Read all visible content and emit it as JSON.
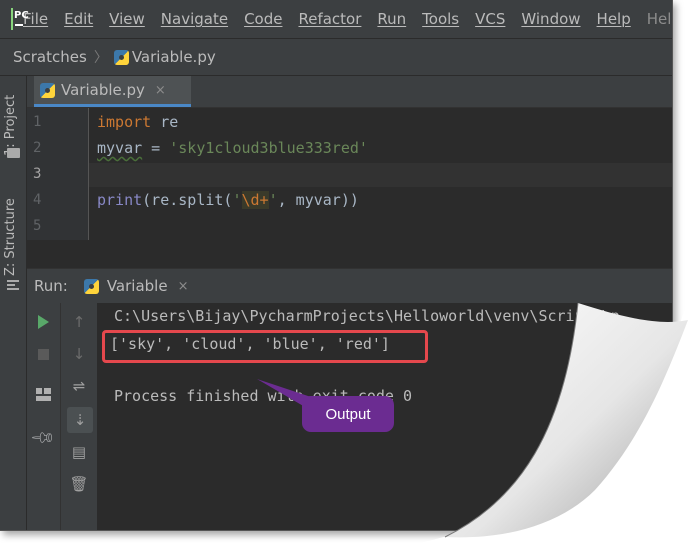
{
  "menu": {
    "items": [
      "File",
      "Edit",
      "View",
      "Navigate",
      "Code",
      "Refactor",
      "Run",
      "Tools",
      "VCS",
      "Window",
      "Help"
    ],
    "window_title": "Hello"
  },
  "breadcrumb": {
    "root": "Scratches",
    "file": "Variable.py"
  },
  "left_strip": {
    "project_tab": "1: Project",
    "structure_tab": "Z: Structure"
  },
  "editor_tab": {
    "label": "Variable.py",
    "close": "×"
  },
  "editor": {
    "line_numbers": [
      "1",
      "2",
      "3",
      "4",
      "5"
    ],
    "current_line": "3",
    "line1": {
      "kw": "import",
      "rest": " re"
    },
    "line2": {
      "var": "myvar",
      "op": " = ",
      "str": "'sky1cloud3blue333red'"
    },
    "line4": {
      "builtin": "print",
      "pre": "(re.split(",
      "str_open": "'",
      "esc": "\\d+",
      "str_close": "'",
      "post": ", myvar))"
    }
  },
  "run_panel": {
    "title": "Run:",
    "tab_label": "Variable",
    "tab_close": "×"
  },
  "console": {
    "path_line": "C:\\Users\\Bijay\\PycharmProjects\\Helloworld\\venv\\Scripts\\p",
    "output_line": "['sky', 'cloud', 'blue', 'red']",
    "exit_line": "Process finished with exit code 0"
  },
  "callout": {
    "label": "Output"
  },
  "colors": {
    "keyword": "#cc7832",
    "string": "#6a8759",
    "builtin": "#8888c6",
    "highlight_border": "#e5484d",
    "callout_bg": "#6b2c91",
    "run_green": "#59a869"
  },
  "icons": {
    "run": "play-icon",
    "stop": "stop-icon",
    "layout": "layout-icon",
    "pin": "pin-icon",
    "rerun_up": "arrow-up-icon",
    "rerun_down": "arrow-down-icon",
    "soft_wrap": "soft-wrap-icon",
    "scroll_end": "scroll-to-end-icon",
    "print": "print-icon",
    "trash": "trash-icon"
  }
}
